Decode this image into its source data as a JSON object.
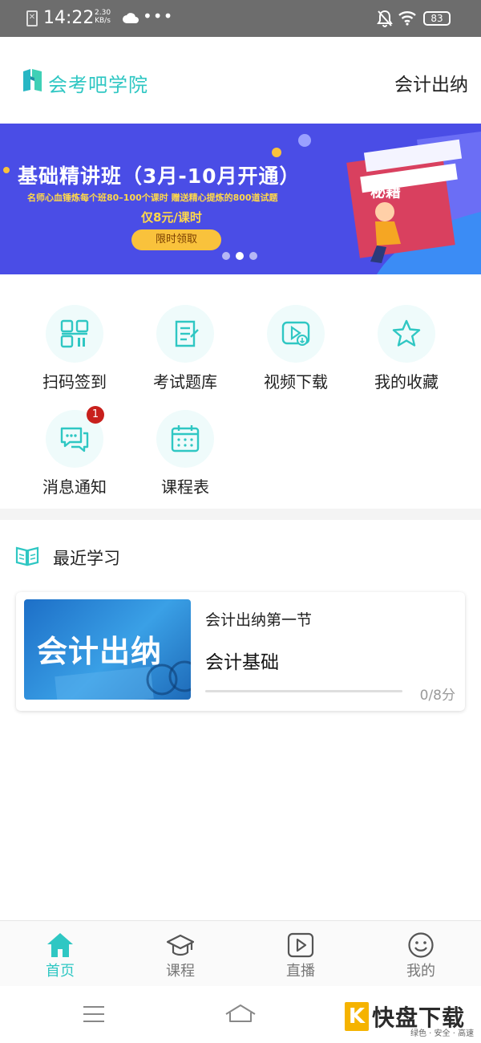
{
  "status_bar": {
    "time": "14:22",
    "net_speed_value": "2.30",
    "net_speed_unit": "KB/s",
    "sim_glyph": "✕",
    "more_dots": "•••",
    "battery": "83"
  },
  "header": {
    "logo_text": "会考吧学院",
    "right_label": "会计出纳"
  },
  "banner": {
    "title": "基础精讲班（3月-10月开通）",
    "subtitle": "名师心血锤炼每个班80–100个课时 赠送精心提炼的800道试题",
    "price": "仅8元/课时",
    "button": "限时领取",
    "book_label": "秘籍",
    "page_count": 3,
    "active_page": 2
  },
  "grid": [
    {
      "label": "扫码签到",
      "icon": "qr-code-icon"
    },
    {
      "label": "考试题库",
      "icon": "exam-bank-icon"
    },
    {
      "label": "视频下载",
      "icon": "video-download-icon"
    },
    {
      "label": "我的收藏",
      "icon": "star-icon"
    },
    {
      "label": "消息通知",
      "icon": "message-icon",
      "badge": "1"
    },
    {
      "label": "课程表",
      "icon": "calendar-icon"
    }
  ],
  "recent": {
    "title": "最近学习",
    "card": {
      "thumb_text": "会计出纳",
      "subtitle": "会计出纳第一节",
      "title": "会计基础",
      "progress": "0/8分",
      "progress_fraction": 0
    }
  },
  "tabbar": [
    {
      "label": "首页",
      "icon": "home-icon",
      "active": true
    },
    {
      "label": "课程",
      "icon": "graduation-cap-icon",
      "active": false
    },
    {
      "label": "直播",
      "icon": "play-icon",
      "active": false
    },
    {
      "label": "我的",
      "icon": "smile-icon",
      "active": false
    }
  ],
  "watermark": {
    "k": "K",
    "main": "快盘下载",
    "sub": "绿色 · 安全 · 高速"
  },
  "colors": {
    "accent": "#2fc7c3",
    "banner_bg": "#4a4de6",
    "badge": "#c8201c",
    "status_bar": "#6d6d6d"
  }
}
